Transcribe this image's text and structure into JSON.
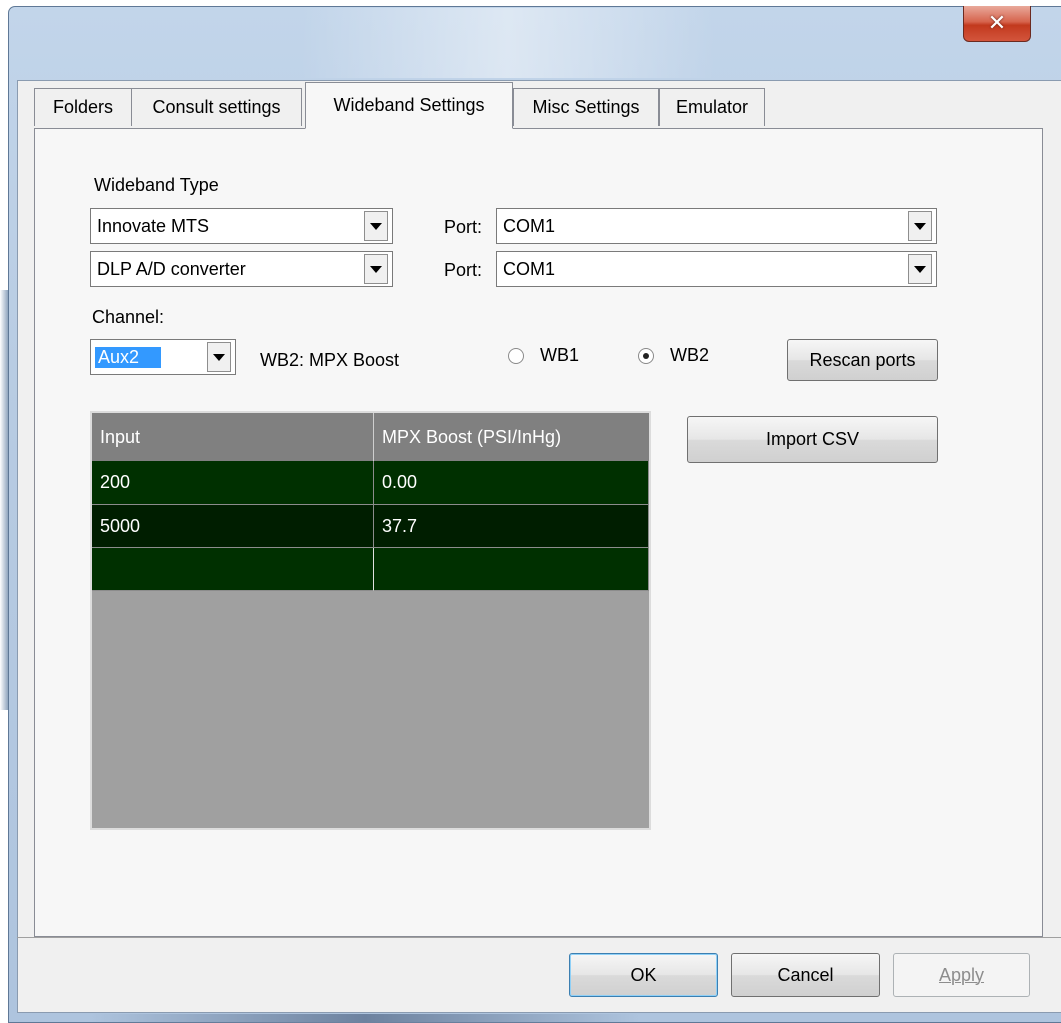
{
  "window": {
    "close_symbol": "✕"
  },
  "tabs": [
    {
      "label": "Folders"
    },
    {
      "label": "Consult settings"
    },
    {
      "label": "Wideband Settings"
    },
    {
      "label": "Misc Settings"
    },
    {
      "label": "Emulator"
    }
  ],
  "wideband": {
    "type_label": "Wideband Type",
    "type1": "Innovate MTS",
    "type2": "DLP A/D converter",
    "port_label": "Port:",
    "port1": "COM1",
    "port2": "COM1",
    "channel_label": "Channel:",
    "channel": "Aux2",
    "channel_desc": "WB2: MPX Boost",
    "radio_wb1": "WB1",
    "radio_wb2": "WB2",
    "selected_radio": "WB2",
    "rescan_label": "Rescan ports",
    "import_label": "Import CSV"
  },
  "table": {
    "headers": [
      "Input",
      "MPX Boost (PSI/InHg)"
    ],
    "rows": [
      [
        "200",
        "0.00"
      ],
      [
        "5000",
        "37.7"
      ],
      [
        "",
        ""
      ]
    ]
  },
  "footer": {
    "ok": "OK",
    "cancel": "Cancel",
    "apply": "Apply"
  },
  "colors": {
    "row_background": "#003000",
    "row_background_alt": "#001e00",
    "header_background": "#808080",
    "selection": "#3399ff"
  },
  "icons": {
    "dropdown": "chevron-down-icon",
    "close": "close-icon"
  }
}
